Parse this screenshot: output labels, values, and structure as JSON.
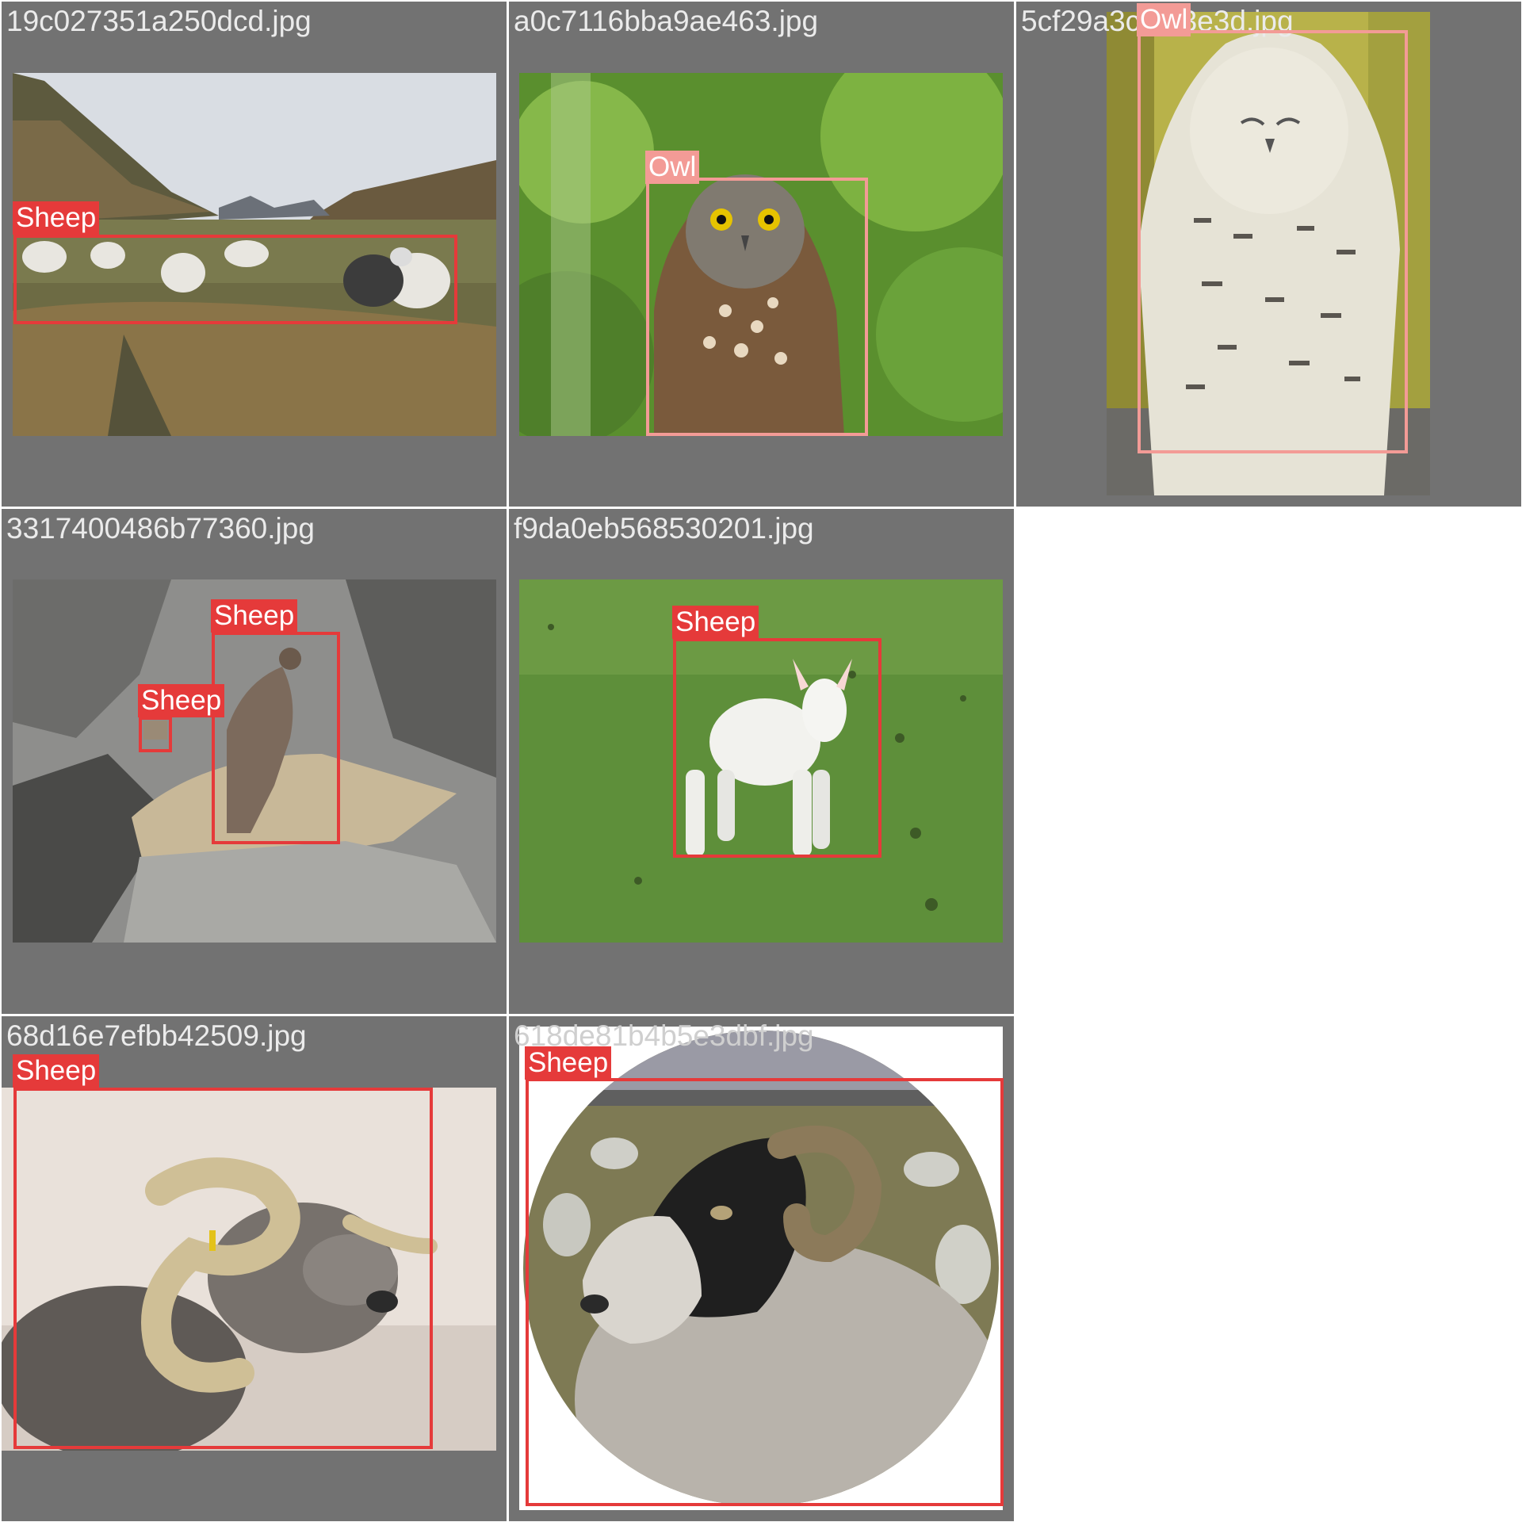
{
  "tiles": [
    {
      "filename": "19c027351a250dcd.jpg",
      "label": "Sheep",
      "class": "sheep"
    },
    {
      "filename": "a0c7116bba9ae463.jpg",
      "label": "Owl",
      "class": "owl"
    },
    {
      "filename": "5cf29a3c...13e3d.jpg",
      "label": "Owl",
      "class": "owl"
    },
    {
      "filename": "3317400486b77360.jpg",
      "labels": [
        "Sheep",
        "Sheep"
      ],
      "class": "sheep"
    },
    {
      "filename": "f9da0eb568530201.jpg",
      "label": "Sheep",
      "class": "sheep"
    },
    {
      "filename": "68d16e7efbb42509.jpg",
      "label": "Sheep",
      "class": "sheep"
    },
    {
      "filename": "618de81b4b5e3dbf.jpg",
      "label": "Sheep",
      "class": "sheep"
    }
  ],
  "colors": {
    "tile_bg": "#727272",
    "sheep_box": "#e53a3a",
    "owl_box": "#f39b96",
    "title_text": "#ebebeb"
  }
}
